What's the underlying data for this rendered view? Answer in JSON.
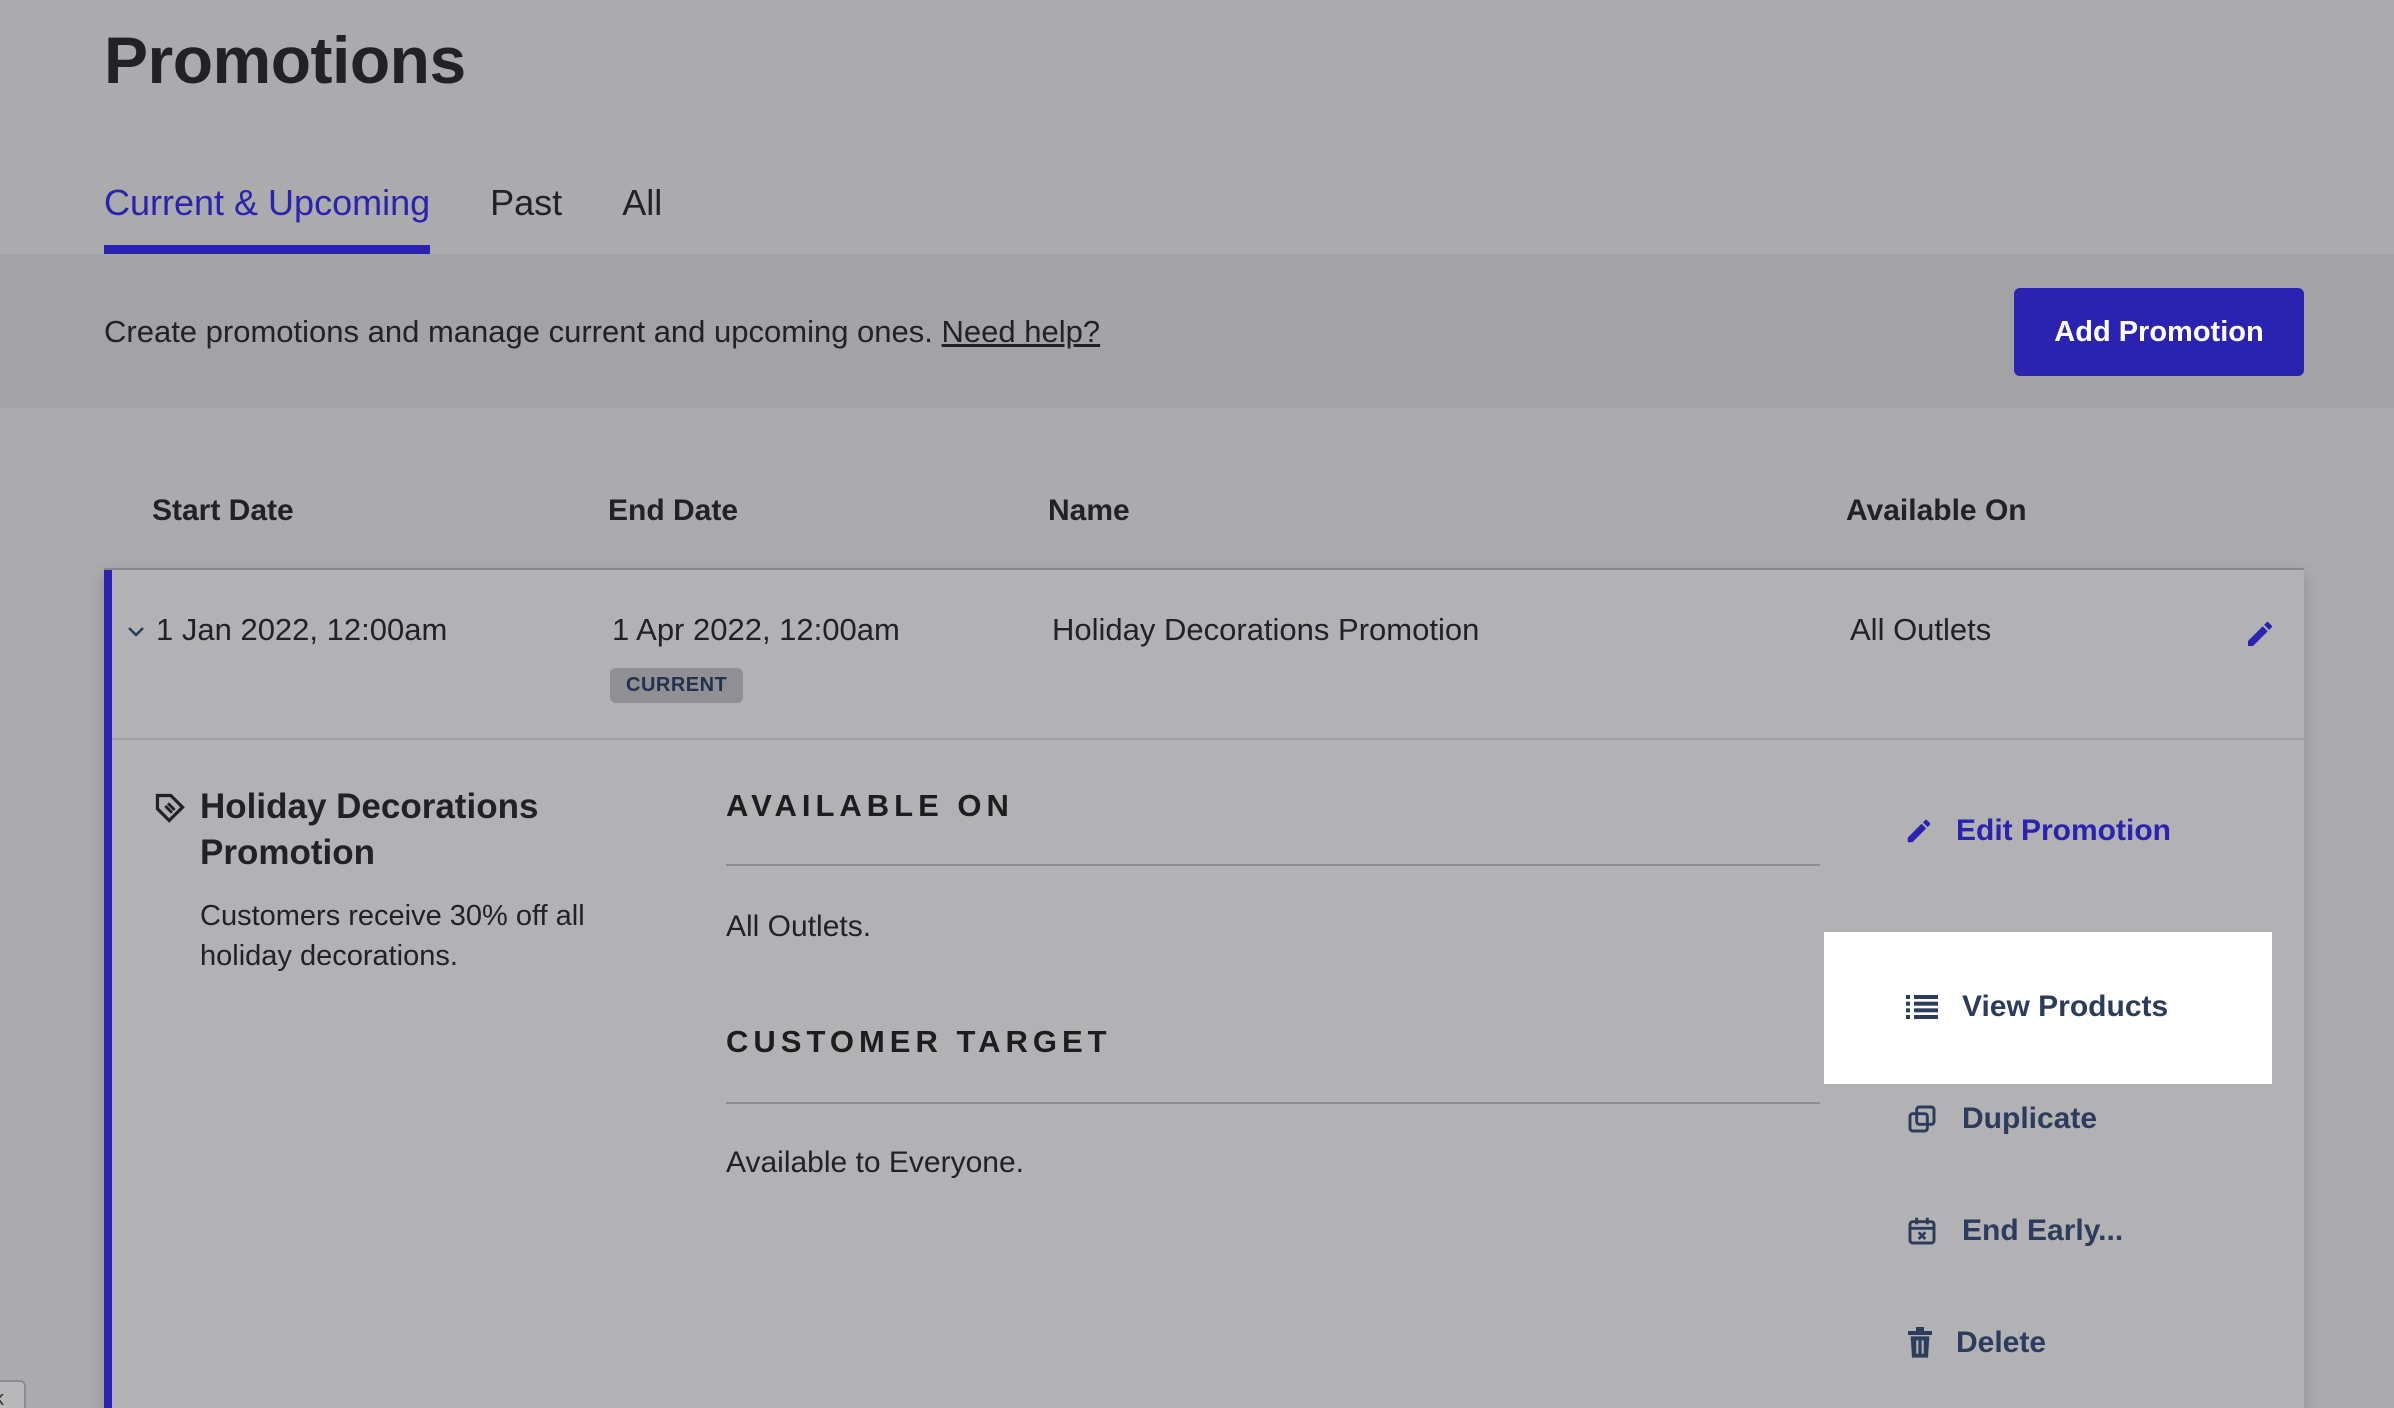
{
  "page": {
    "title": "Promotions"
  },
  "tabs": [
    {
      "label": "Current & Upcoming",
      "active": true
    },
    {
      "label": "Past",
      "active": false
    },
    {
      "label": "All",
      "active": false
    }
  ],
  "info_bar": {
    "text": "Create promotions and manage current and upcoming ones.",
    "help_link": "Need help?",
    "add_button": "Add Promotion"
  },
  "table": {
    "columns": [
      "Start Date",
      "End Date",
      "Name",
      "Available On"
    ],
    "rows": [
      {
        "start_date": "1 Jan 2022, 12:00am",
        "end_date": "1 Apr 2022, 12:00am",
        "status_badge": "CURRENT",
        "name": "Holiday Decorations Promotion",
        "available_on": "All Outlets"
      }
    ]
  },
  "detail": {
    "title": "Holiday Decorations Promotion",
    "description": "Customers receive 30% off all holiday decorations.",
    "available_on_heading": "AVAILABLE ON",
    "available_on_text": "All Outlets.",
    "customer_target_heading": "CUSTOMER TARGET",
    "customer_target_text": "Available to Everyone.",
    "actions": {
      "edit": "Edit Promotion",
      "view_products": "View Products",
      "duplicate": "Duplicate",
      "end_early": "End Early...",
      "delete": "Delete"
    }
  },
  "corner_tag": "k",
  "colors": {
    "accent": "#2a22b0",
    "action_text": "#2c3c5c",
    "badge_bg": "#8f8f94",
    "overlay_bg": "#ababad"
  }
}
